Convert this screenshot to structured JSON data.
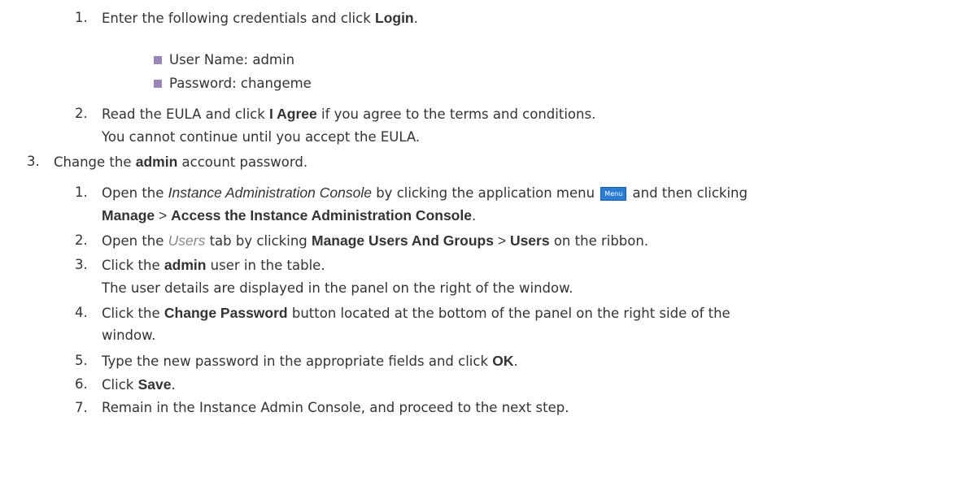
{
  "steps": {
    "s2_1": {
      "num": "1.",
      "pre": "Enter the following credentials and click ",
      "bold": "Login",
      "post": "."
    },
    "bullets": [
      "User Name: admin",
      "Password: changeme"
    ],
    "s2_2": {
      "num": "2.",
      "pre": "Read the EULA and click ",
      "bold": "I Agree",
      "post": " if you agree to the terms and conditions.",
      "note": "You cannot continue until you accept the EULA."
    },
    "s3": {
      "num": "3.",
      "pre": "Change the ",
      "bold": "admin",
      "post": " account password."
    },
    "s3_1": {
      "num": "1.",
      "pre": "Open the ",
      "italic": "Instance Administration Console",
      "mid": " by clicking the application menu ",
      "menu_label": "Menu",
      "post": " and then clicking",
      "line2_bold1": "Manage",
      "line2_sep": " > ",
      "line2_bold2": "Access the Instance Administration Console",
      "line2_post": "."
    },
    "s3_2": {
      "num": "2.",
      "pre": "Open the ",
      "italic": "Users",
      "mid": " tab by clicking ",
      "bold1": "Manage Users And Groups",
      "sep": " > ",
      "bold2": "Users",
      "post": " on the ribbon."
    },
    "s3_3": {
      "num": "3.",
      "pre": "Click the ",
      "bold": "admin",
      "post": " user in the table.",
      "note": "The user details are displayed in the panel on the right of the window."
    },
    "s3_4": {
      "num": "4.",
      "pre": "Click the ",
      "bold": "Change Password",
      "post": " button located at the bottom of the panel on the right side of the",
      "line2": "window."
    },
    "s3_5": {
      "num": "5.",
      "pre": "Type the new password in the appropriate fields and click ",
      "bold": "OK",
      "post": "."
    },
    "s3_6": {
      "num": "6.",
      "pre": "Click ",
      "bold": "Save",
      "post": "."
    },
    "s3_7": {
      "num": "7.",
      "text": "Remain in the Instance Admin Console, and proceed to the next step."
    }
  }
}
